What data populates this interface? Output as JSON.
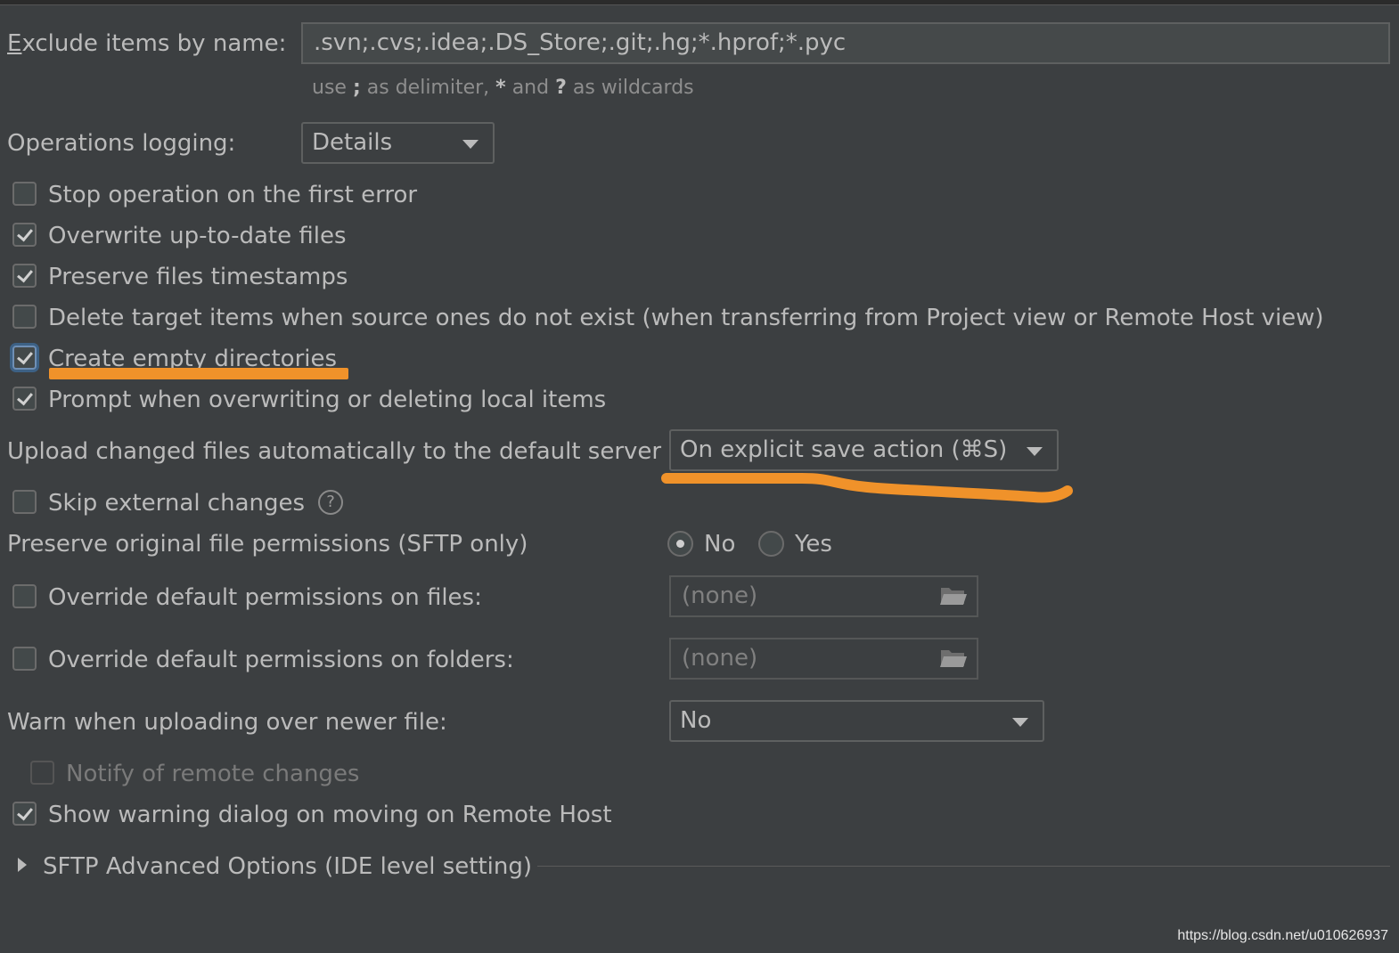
{
  "exclude": {
    "label_mnemonic": "E",
    "label_rest": "xclude items by name:",
    "value": ".svn;.cvs;.idea;.DS_Store;.git;.hg;*.hprof;*.pyc",
    "hint_use": "use",
    "hint_semicolon": ";",
    "hint_as_delimiter": "as delimiter,",
    "hint_star": "*",
    "hint_and": "and",
    "hint_q": "?",
    "hint_as_wildcards": "as wildcards"
  },
  "operations_logging": {
    "label": "Operations logging:",
    "value": "Details"
  },
  "checkboxes": [
    {
      "label": "Stop operation on the first error",
      "checked": false
    },
    {
      "label": "Overwrite up-to-date files",
      "checked": true
    },
    {
      "label": "Preserve files timestamps",
      "checked": true
    },
    {
      "label": "Delete target items when source ones do not exist (when transferring from Project view or Remote Host view)",
      "checked": false
    },
    {
      "label": "Create empty directories",
      "checked": true
    },
    {
      "label": "Prompt when overwriting or deleting local items",
      "checked": true
    }
  ],
  "upload": {
    "label": "Upload changed files automatically to the default server",
    "value": "On explicit save action (⌘S)"
  },
  "skip_external": {
    "label": "Skip external changes",
    "checked": false,
    "help": "?"
  },
  "preserve_permissions": {
    "label": "Preserve original file permissions (SFTP only)",
    "options": [
      "No",
      "Yes"
    ],
    "selected": "No"
  },
  "override_files": {
    "label": "Override default permissions on files:",
    "value": "(none)",
    "checked": false
  },
  "override_folders": {
    "label": "Override default permissions on folders:",
    "value": "(none)",
    "checked": false
  },
  "warn_newer": {
    "label": "Warn when uploading over newer file:",
    "value": "No"
  },
  "notify_remote": {
    "label": "Notify of remote changes",
    "checked": false,
    "disabled": true
  },
  "show_warning": {
    "label": "Show warning dialog on moving on Remote Host",
    "checked": true
  },
  "sftp_advanced": {
    "label": "SFTP Advanced Options (IDE level setting)"
  },
  "annotation_color": "#f0922a",
  "watermark": "https://blog.csdn.net/u010626937"
}
